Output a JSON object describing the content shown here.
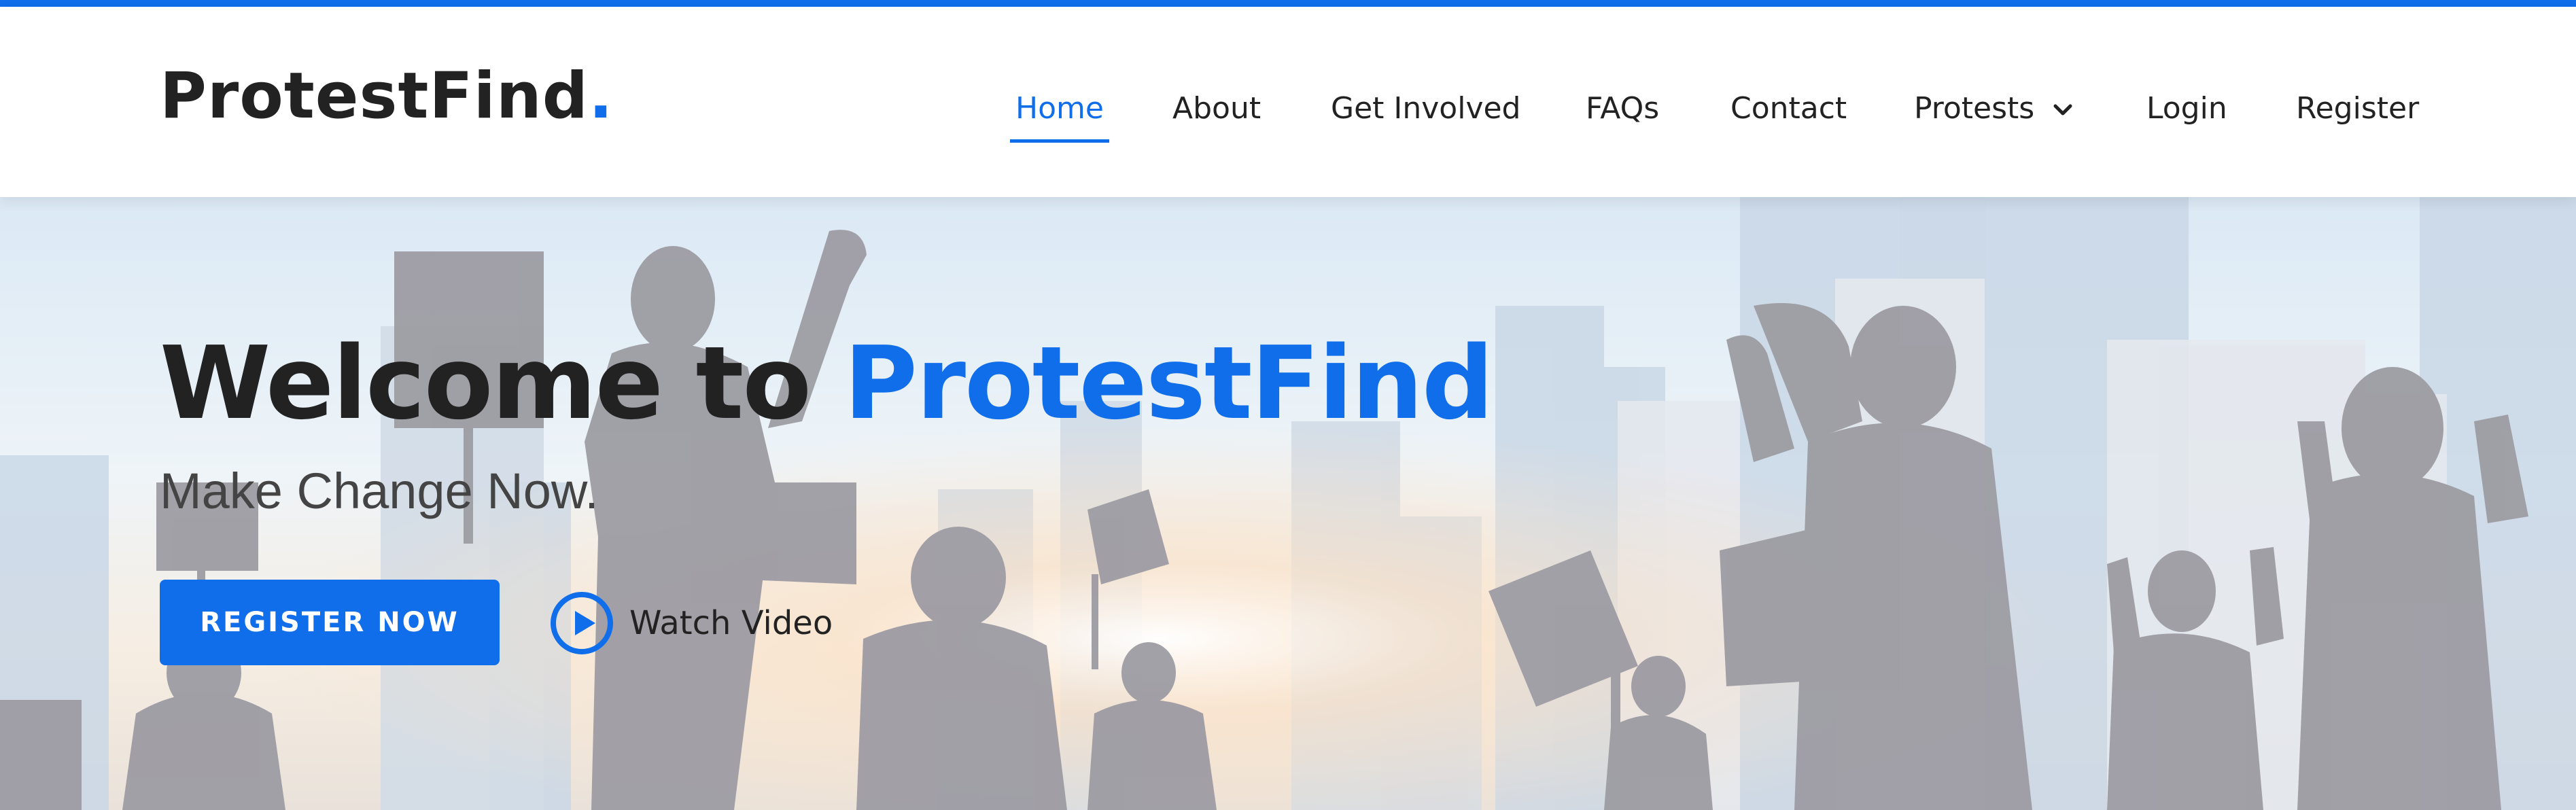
{
  "brand": {
    "name": "ProtestFind",
    "dot": ".",
    "accent_color": "#106eea"
  },
  "nav": {
    "items": [
      {
        "label": "Home",
        "active": true
      },
      {
        "label": "About"
      },
      {
        "label": "Get Involved"
      },
      {
        "label": "FAQs"
      },
      {
        "label": "Contact"
      },
      {
        "label": "Protests",
        "has_dropdown": true,
        "icon": "chevron-down-icon"
      },
      {
        "label": "Login"
      },
      {
        "label": "Register"
      }
    ]
  },
  "hero": {
    "title_prefix": "Welcome to",
    "title_accent": "ProtestFind",
    "subtitle": "Make Change Now.",
    "cta_label": "REGISTER NOW",
    "video_label": "Watch Video",
    "video_icon": "play-circle-icon",
    "background": "protest-crowd-silhouette-city-skyline"
  }
}
